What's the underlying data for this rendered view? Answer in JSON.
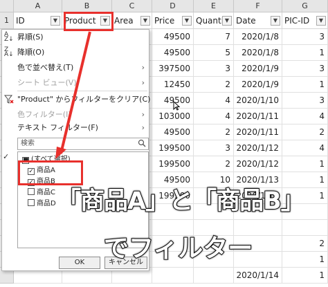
{
  "columns": [
    "A",
    "B",
    "C",
    "D",
    "E",
    "F",
    "G"
  ],
  "header_row_number": "1",
  "headers": [
    "ID",
    "Product",
    "Area",
    "Price",
    "Quantit",
    "Date",
    "PIC-ID"
  ],
  "row_numbers": [
    "",
    "",
    "",
    "",
    "",
    "",
    "",
    "",
    "",
    "",
    "",
    "",
    "",
    "",
    "",
    ""
  ],
  "rows": [
    {
      "price": "49500",
      "qty": "7",
      "date": "2020/1/8",
      "pic": "3"
    },
    {
      "price": "49500",
      "qty": "5",
      "date": "2020/1/8",
      "pic": "1"
    },
    {
      "price": "397500",
      "qty": "3",
      "date": "2020/1/9",
      "pic": "3"
    },
    {
      "price": "12450",
      "qty": "2",
      "date": "2020/1/9",
      "pic": "1"
    },
    {
      "price": "49500",
      "qty": "4",
      "date": "2020/1/10",
      "pic": "3"
    },
    {
      "price": "103000",
      "qty": "4",
      "date": "2020/1/11",
      "pic": "4"
    },
    {
      "price": "49500",
      "qty": "2",
      "date": "2020/1/11",
      "pic": "2"
    },
    {
      "price": "199500",
      "qty": "3",
      "date": "2020/1/12",
      "pic": "4"
    },
    {
      "price": "199500",
      "qty": "2",
      "date": "2020/1/12",
      "pic": "1"
    },
    {
      "price": "49500",
      "qty": "10",
      "date": "2020/1/13",
      "pic": "1"
    },
    {
      "price": "199500",
      "qty": "2",
      "date": "2020/1/13",
      "pic": "1"
    },
    {
      "price": "",
      "qty": "",
      "date": "",
      "pic": ""
    },
    {
      "price": "",
      "qty": "",
      "date": "",
      "pic": ""
    },
    {
      "price": "",
      "qty": "",
      "date": "",
      "pic": "2"
    },
    {
      "price": "",
      "qty": "",
      "date": "",
      "pic": "1"
    },
    {
      "price": "",
      "qty": "",
      "date": "2020/1/14",
      "pic": "1"
    }
  ],
  "menu": {
    "sort_asc": "昇順(S)",
    "sort_desc": "降順(O)",
    "sort_color": "色で並べ替え(T)",
    "sheet_view": "シート ビュー(V)",
    "clear_filter": "\"Product\" からフィルターをクリア(C)",
    "color_filter": "色フィルター(I)",
    "text_filter": "テキスト フィルター(F)",
    "search_placeholder": "検索",
    "items": [
      "(すべて選択)",
      "商品A",
      "商品B",
      "商品C",
      "商品D"
    ],
    "ok": "OK",
    "cancel": "キャンセル"
  },
  "captions": {
    "line1": "「商品A」と「商品B」",
    "line2": "でフィルター"
  },
  "colors": {
    "accent_red": "#e8302c"
  }
}
